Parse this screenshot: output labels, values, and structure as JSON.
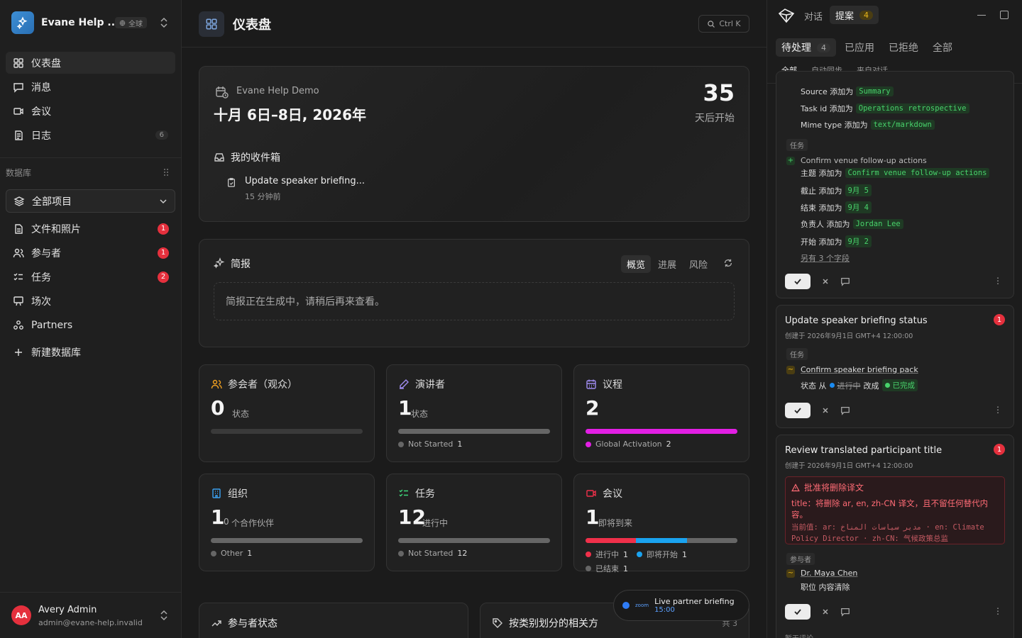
{
  "workspace": {
    "name": "Evane Help ...",
    "scope": "全球"
  },
  "sidebar": {
    "nav": [
      {
        "label": "仪表盘"
      },
      {
        "label": "消息"
      },
      {
        "label": "会议"
      },
      {
        "label": "日志",
        "count": "6"
      }
    ],
    "section_label": "数据库",
    "db_select": "全部项目",
    "db_items": [
      {
        "label": "文件和照片",
        "badge": "1"
      },
      {
        "label": "参与者",
        "badge": "1"
      },
      {
        "label": "任务",
        "badge": "2"
      },
      {
        "label": "场次"
      },
      {
        "label": "Partners"
      }
    ],
    "new_db": "新建数据库",
    "user": {
      "initials": "AA",
      "name": "Avery Admin",
      "email": "admin@evane-help.invalid"
    }
  },
  "topbar": {
    "title": "仪表盘",
    "shortcut": "Ctrl K"
  },
  "hero": {
    "org": "Evane Help Demo",
    "date": "十月 6日–8日, 2026年",
    "days": "35",
    "days_label": "天后开始",
    "inbox_title": "我的收件箱",
    "inbox_item": "Update speaker briefing...",
    "inbox_time": "15 分钟前"
  },
  "brief": {
    "title": "简报",
    "tabs": [
      "概览",
      "进展",
      "风险"
    ],
    "message": "简报正在生成中，请稍后再来查看。"
  },
  "stats": [
    {
      "label": "参会者（观众）",
      "num": "0",
      "unit": "状态",
      "legend": []
    },
    {
      "label": "演讲者",
      "num": "1",
      "unit": "状态",
      "legend": [
        {
          "name": "Not Started",
          "count": "1",
          "color": "#666666"
        }
      ]
    },
    {
      "label": "议程",
      "num": "2",
      "unit": "",
      "legend": [
        {
          "name": "Global Activation",
          "count": "2",
          "color": "#e21fe4"
        }
      ]
    },
    {
      "label": "组织",
      "num": "1",
      "unit": "个合作伙伴",
      "unit_prefix": "0",
      "legend": [
        {
          "name": "Other",
          "count": "1",
          "color": "#666666"
        }
      ]
    },
    {
      "label": "任务",
      "num": "12",
      "unit": "进行中",
      "legend": [
        {
          "name": "Not Started",
          "count": "12",
          "color": "#666666"
        }
      ]
    },
    {
      "label": "会议",
      "num": "1",
      "unit": "即将到来",
      "legend": [
        {
          "name": "进行中",
          "count": "1",
          "color": "#f0304a"
        },
        {
          "name": "即将开始",
          "count": "1",
          "color": "#1aa3f0"
        },
        {
          "name": "已结束",
          "count": "1",
          "color": "#666666"
        }
      ]
    }
  ],
  "bottom": {
    "left_title": "参与者状态",
    "right_title": "按类别划分的相关方",
    "right_count": "共 3"
  },
  "toast": {
    "brand": "zoom",
    "title": "Live partner briefing",
    "time": "15:00"
  },
  "right": {
    "tab_chat": "对话",
    "tab_proposals": "提案",
    "proposals_count": "4",
    "tabs": [
      {
        "label": "待处理",
        "count": "4"
      },
      {
        "label": "已应用"
      },
      {
        "label": "已拒绝"
      },
      {
        "label": "全部"
      }
    ],
    "subtabs": [
      "全部",
      "自动同步",
      "来自对话"
    ],
    "card1": {
      "rows": [
        {
          "k": "Source 添加为",
          "v": "Summary"
        },
        {
          "k": "Task id 添加为",
          "v": "Operations retrospective"
        },
        {
          "k": "Mime type 添加为",
          "v": "text/markdown"
        }
      ],
      "tag": "任务",
      "item": "Confirm venue follow-up actions",
      "fields": [
        {
          "k": "主题 添加为",
          "v": "Confirm venue follow-up actions"
        },
        {
          "k": "截止 添加为",
          "v": "9月 5"
        },
        {
          "k": "结束 添加为",
          "v": "9月 4"
        },
        {
          "k": "负责人 添加为",
          "v": "Jordan Lee"
        },
        {
          "k": "开始 添加为",
          "v": "9月 2"
        }
      ],
      "more": "另有 3 个字段"
    },
    "card2": {
      "title": "Update speaker briefing status",
      "badge": "1",
      "created": "创建于 2026年9月1日 GMT+4 12:00:00",
      "tag": "任务",
      "item": "Confirm speaker briefing pack",
      "status_from_label": "状态 从",
      "status_old": "进行中",
      "status_change": "改成",
      "status_new": "已完成"
    },
    "card3": {
      "title": "Review translated participant title",
      "badge": "1",
      "created": "创建于 2026年9月1日 GMT+4 12:00:00",
      "warn_title": "批准将删除译文",
      "warn_body": "title：将删除 ar, en, zh-CN 译文，且不留任何替代内容。",
      "warn_current": "当前值: ar: مدير سياسات المناخ · en: Climate Policy Director · zh-CN: 气候政策总监",
      "tag": "参与者",
      "item": "Dr. Maya Chen",
      "field": "职位 内容清除",
      "footer": "暂无评论"
    }
  }
}
